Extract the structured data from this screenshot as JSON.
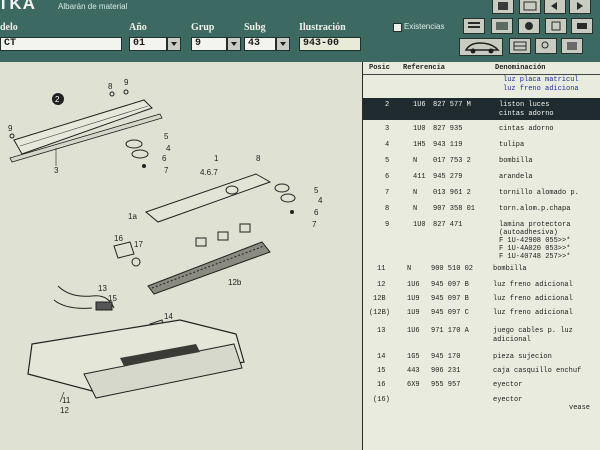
{
  "header": {
    "app_title": "TKA",
    "app_subtitle": "Albarán de material",
    "labels": {
      "modelo": "delo",
      "ano": "Año",
      "grupo": "Grup",
      "subgrupo": "Subg",
      "ilustracion": "Ilustración"
    },
    "values": {
      "modelo": "CT",
      "ano": "01",
      "grupo": "9",
      "subgrupo": "43",
      "ilustracion": "943-00"
    },
    "existencias_label": "Existencias"
  },
  "diagram": {
    "callouts": [
      "2",
      "8",
      "9",
      "9",
      "3",
      "5",
      "4",
      "6",
      "7",
      "1",
      "4.6.7",
      "8",
      "5",
      "4",
      "6",
      "7",
      "1a",
      "16",
      "17",
      "12b",
      "13",
      "15",
      "14",
      "11",
      "12"
    ]
  },
  "table": {
    "headers": {
      "pos": "Posic",
      "ref": "Referencia",
      "den": "Denominación"
    },
    "top_lines": [
      "luz placa matricul",
      "luz freno adiciona"
    ],
    "rows": [
      {
        "pos": "2",
        "p1": "1U6",
        "p2": "827 577 M",
        "p3": "",
        "desc": "liston luces",
        "desc2": "cintas adorno",
        "selected": true
      },
      {
        "pos": "3",
        "p1": "1U0",
        "p2": "827 935",
        "p3": "",
        "desc": "cintas adorno"
      },
      {
        "pos": "4",
        "p1": "1H5",
        "p2": "943 119",
        "p3": "",
        "desc": "tulipa"
      },
      {
        "pos": "5",
        "p1": "N",
        "p2": "017 753 2",
        "p3": "",
        "desc": "bombilla"
      },
      {
        "pos": "6",
        "p1": "411",
        "p2": "945 279",
        "p3": "",
        "desc": "arandela"
      },
      {
        "pos": "7",
        "p1": "N",
        "p2": "013 961 2",
        "p3": "",
        "desc": "tornillo alomado p."
      },
      {
        "pos": "8",
        "p1": "N",
        "p2": "907 358 01",
        "p3": "",
        "desc": "torn.alom.p.chapa"
      },
      {
        "pos": "9",
        "p1": "1U0",
        "p2": "827 471",
        "p3": "",
        "desc": "lamina protectora",
        "desc2": "(autoadhesiva)",
        "desc3": "F 1U-42908 055>>*",
        "desc4": "F 1U-4A020 053>>*",
        "desc5": "F 1U-40748 257>>*"
      },
      {
        "pos": "11",
        "p1": "N",
        "p2": "900 510 02",
        "p3": "",
        "desc": "bombilla"
      },
      {
        "pos": "12",
        "p1": "1U6",
        "p2": "945 097 B",
        "p3": "",
        "desc": "luz freno adicional"
      },
      {
        "pos": "12B",
        "p1": "1U9",
        "p2": "945 097 B",
        "p3": "",
        "desc": "luz freno adicional"
      },
      {
        "pos": "(12B)",
        "p1": "1U9",
        "p2": "945 097 C",
        "p3": "",
        "desc": "luz freno adicional"
      },
      {
        "pos": "13",
        "p1": "1U6",
        "p2": "971 170 A",
        "p3": "",
        "desc": "juego cables p. luz",
        "desc2": "adicional"
      },
      {
        "pos": "14",
        "p1": "1G5",
        "p2": "945 170",
        "p3": "",
        "desc": "pieza sujecion"
      },
      {
        "pos": "15",
        "p1": "443",
        "p2": "906 231",
        "p3": "",
        "desc": "caja casquillo enchuf"
      },
      {
        "pos": "16",
        "p1": "6X9",
        "p2": "955 957",
        "p3": "",
        "desc": "eyector"
      },
      {
        "pos": "(16)",
        "p1": "",
        "p2": "",
        "p3": "",
        "desc": "eyector",
        "desc2": "vease"
      }
    ]
  },
  "colors": {
    "header_bg": "#3c6a62",
    "selection_bg": "#1f2b2e",
    "link_blue": "#2030a0"
  },
  "toolbar_icons": [
    "print-icon",
    "export-icon",
    "back-icon",
    "forward-icon",
    "car-icon",
    "list-icon",
    "image-icon",
    "parts-icon"
  ]
}
